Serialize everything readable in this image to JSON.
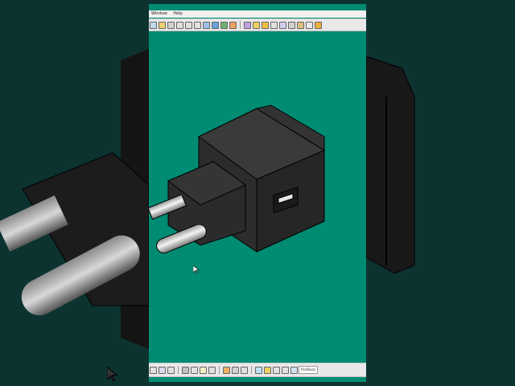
{
  "menu": {
    "items": [
      "Window",
      "Help"
    ]
  },
  "toolbar_bottom": {
    "part_body": "PartBody"
  },
  "colors": {
    "viewport_bg": "#008b73",
    "outer_bg": "#0d3330",
    "model": "#2a2a2a"
  }
}
